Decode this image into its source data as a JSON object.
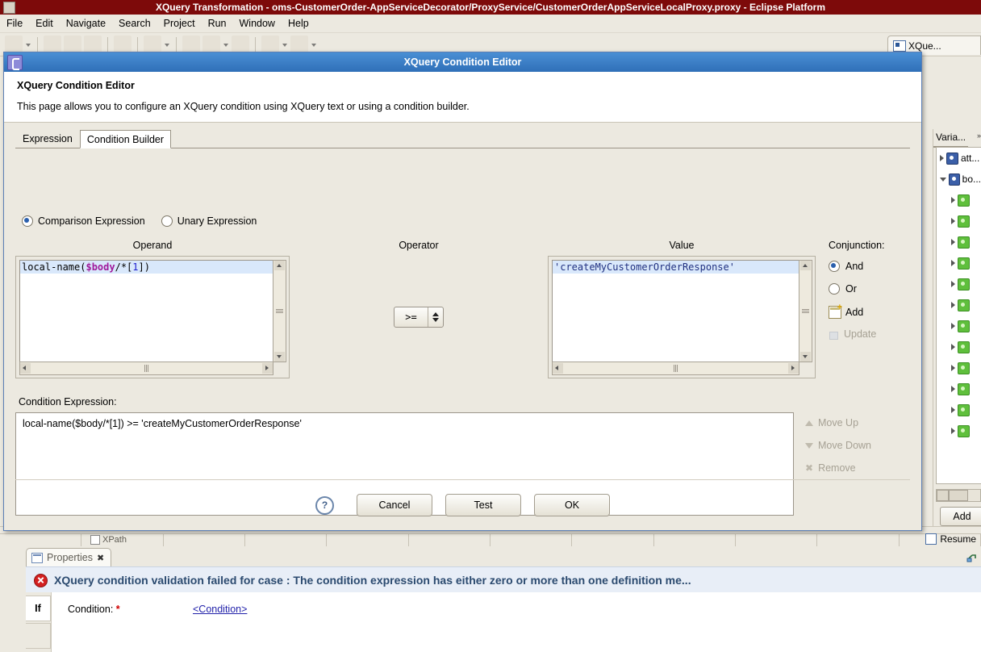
{
  "window": {
    "title": "XQuery Transformation - oms-CustomerOrder-AppServiceDecorator/ProxyService/CustomerOrderAppServiceLocalProxy.proxy - Eclipse Platform",
    "app_icon": "eclipse-icon",
    "menus": [
      "File",
      "Edit",
      "Navigate",
      "Search",
      "Project",
      "Run",
      "Window",
      "Help"
    ],
    "editor_tab_label": "XQue..."
  },
  "variables_panel": {
    "tab_label": "Varia...",
    "minimize_label": "»",
    "add_button": "Add",
    "nodes": [
      {
        "label": "att...",
        "icon": "blue-variable-icon",
        "expanded": false,
        "indent": false
      },
      {
        "label": "bo...",
        "icon": "blue-variable-icon",
        "expanded": true,
        "indent": false
      },
      {
        "label": "",
        "icon": "green-element-icon",
        "expanded": false,
        "indent": true
      },
      {
        "label": "",
        "icon": "green-element-icon",
        "expanded": false,
        "indent": true
      },
      {
        "label": "",
        "icon": "green-element-icon",
        "expanded": false,
        "indent": true
      },
      {
        "label": "",
        "icon": "green-element-icon",
        "expanded": false,
        "indent": true
      },
      {
        "label": "",
        "icon": "green-element-icon",
        "expanded": false,
        "indent": true
      },
      {
        "label": "",
        "icon": "green-element-icon",
        "expanded": false,
        "indent": true
      },
      {
        "label": "",
        "icon": "green-element-icon",
        "expanded": false,
        "indent": true
      },
      {
        "label": "",
        "icon": "green-element-icon",
        "expanded": false,
        "indent": true
      },
      {
        "label": "",
        "icon": "green-element-icon",
        "expanded": false,
        "indent": true
      },
      {
        "label": "",
        "icon": "green-element-icon",
        "expanded": false,
        "indent": true
      },
      {
        "label": "",
        "icon": "green-element-icon",
        "expanded": false,
        "indent": true
      },
      {
        "label": "",
        "icon": "green-element-icon",
        "expanded": false,
        "indent": true
      }
    ]
  },
  "editor_strip": {
    "xpath_tab": "XPath",
    "resume_label": "Resume"
  },
  "dialog": {
    "titlebar": "XQuery Condition Editor",
    "heading": "XQuery Condition Editor",
    "description": "This page allows you to configure an XQuery condition using XQuery text or using a condition builder.",
    "tabs": [
      {
        "label": "Expression",
        "active": false
      },
      {
        "label": "Condition Builder",
        "active": true
      }
    ],
    "expression_type": {
      "comparison_label": "Comparison Expression",
      "unary_label": "Unary Expression",
      "selected": "Comparison Expression"
    },
    "columns": {
      "operand_header": "Operand",
      "operator_header": "Operator",
      "value_header": "Value",
      "conjunction_header": "Conjunction:"
    },
    "operand": {
      "text": "local-name($body/*[1])",
      "tokens": [
        {
          "t": "local-name(",
          "k": "plain"
        },
        {
          "t": "$body",
          "k": "variable"
        },
        {
          "t": "/*[",
          "k": "plain"
        },
        {
          "t": "1",
          "k": "number"
        },
        {
          "t": "])",
          "k": "plain"
        }
      ]
    },
    "operator": {
      "selected": ">=",
      "options": [
        "=",
        "!=",
        "<",
        "<=",
        ">",
        ">="
      ]
    },
    "value": {
      "text": "'createMyCustomerOrderResponse'"
    },
    "conjunction": {
      "and_label": "And",
      "or_label": "Or",
      "selected": "And",
      "add_label": "Add",
      "update_label": "Update",
      "update_enabled": false
    },
    "condition_expression": {
      "label": "Condition Expression:",
      "text": "local-name($body/*[1]) >= 'createMyCustomerOrderResponse'"
    },
    "list_actions": [
      {
        "label": "Move Up",
        "icon": "arrow-up-icon",
        "enabled": false
      },
      {
        "label": "Move Down",
        "icon": "arrow-down-icon",
        "enabled": false
      },
      {
        "label": "Remove",
        "icon": "remove-x-icon",
        "enabled": false
      }
    ],
    "buttons": {
      "help": "?",
      "cancel": "Cancel",
      "test": "Test",
      "ok": "OK"
    }
  },
  "properties_view": {
    "tab_label": "Properties",
    "close_glyph": "✖",
    "error_message": "XQuery condition validation failed for case : The condition expression has either zero or more than one definition me...",
    "side_tab": "If",
    "field_label": "Condition:",
    "required_mark": "*",
    "field_link": "<Condition>"
  },
  "colors": {
    "dialog_title_blue": "#2f6fb8",
    "error_red": "#d32020",
    "error_text": "#2b4a6f",
    "selection_blue": "#d9e8fb",
    "link_blue": "#2222aa",
    "window_title_bar": "#7d0a0a"
  }
}
